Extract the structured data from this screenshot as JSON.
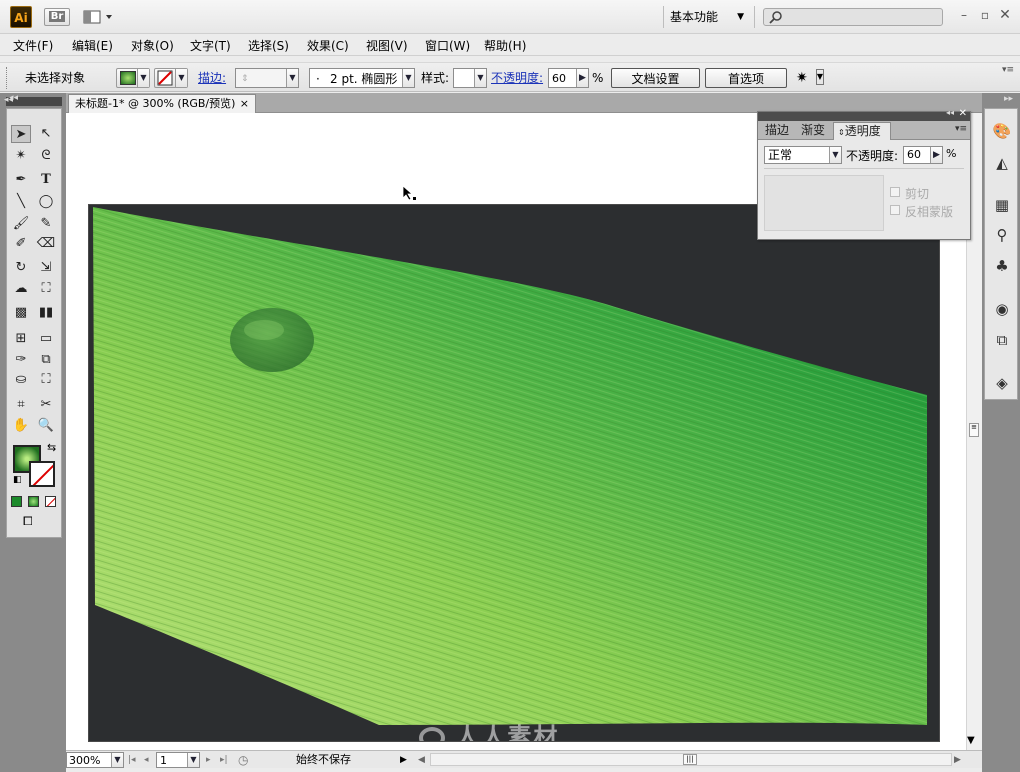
{
  "app": {
    "logo_text": "Ai",
    "bridge_label": "Br",
    "workspace_label": "基本功能"
  },
  "menu": [
    "文件(F)",
    "编辑(E)",
    "对象(O)",
    "文字(T)",
    "选择(S)",
    "效果(C)",
    "视图(V)",
    "窗口(W)",
    "帮助(H)"
  ],
  "control_bar": {
    "selection_status": "未选择对象",
    "stroke_label": "描边:",
    "brush_value": "2 pt. 椭圆形",
    "style_label": "样式:",
    "opacity_label": "不透明度:",
    "opacity_value": "60",
    "percent": "%",
    "doc_setup_button": "文档设置",
    "preferences_button": "首选项"
  },
  "document_tab": {
    "title": "未标题-1* @ 300% (RGB/预览)",
    "close": "×"
  },
  "transparency_panel": {
    "tabs": [
      "描边",
      "渐变",
      "透明度"
    ],
    "active_tab": "透明度",
    "blend_mode": "正常",
    "opacity_label": "不透明度:",
    "opacity_value": "60",
    "percent": "%",
    "clip_label": "剪切",
    "invert_mask_label": "反相蒙版"
  },
  "status_bar": {
    "zoom": "300%",
    "page": "1",
    "status_text": "始终不保存"
  },
  "watermark": {
    "text": "人人素材"
  },
  "colors": {
    "fill": "#2e8a2e",
    "artwork_background": "#2c2e30",
    "leaf_light": "#b9e27a",
    "leaf_dark": "#1f9a3a",
    "link": "#1b33b8"
  }
}
